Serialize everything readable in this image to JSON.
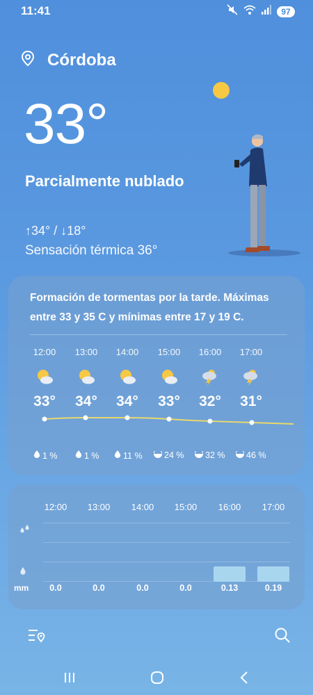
{
  "status": {
    "time": "11:41",
    "battery": "97",
    "icons": [
      "mute-icon",
      "wifi-icon",
      "signal-icon"
    ]
  },
  "header": {
    "city": "Córdoba",
    "current_temp": "33°",
    "condition": "Parcialmente nublado",
    "hi_lo": "↑34° / ↓18°",
    "feels_like": "Sensación térmica 36°"
  },
  "forecast": {
    "summary": "Formación de tormentas por la tarde. Máximas entre 33 y 35 C y mínimas entre 17 y 19 C.",
    "hours": [
      {
        "time": "12:00",
        "icon": "partly-sunny-icon",
        "temp": "33°",
        "precip": "1 %",
        "precip_icon": "drop-icon"
      },
      {
        "time": "13:00",
        "icon": "partly-sunny-icon",
        "temp": "34°",
        "precip": "1 %",
        "precip_icon": "drop-icon"
      },
      {
        "time": "14:00",
        "icon": "partly-sunny-icon",
        "temp": "34°",
        "precip": "11 %",
        "precip_icon": "drop-icon"
      },
      {
        "time": "15:00",
        "icon": "partly-sunny-icon",
        "temp": "33°",
        "precip": "24 %",
        "precip_icon": "half-drop-icon"
      },
      {
        "time": "16:00",
        "icon": "thunderstorm-icon",
        "temp": "32°",
        "precip": "32 %",
        "precip_icon": "half-drop-icon"
      },
      {
        "time": "17:00",
        "icon": "thunderstorm-icon",
        "temp": "31°",
        "precip": "46 %",
        "precip_icon": "half-drop-icon"
      }
    ]
  },
  "rain": {
    "unit": "mm",
    "hours": [
      "12:00",
      "13:00",
      "14:00",
      "15:00",
      "16:00",
      "17:00"
    ],
    "values": [
      "0.0",
      "0.0",
      "0.0",
      "0.0",
      "0.13",
      "0.19"
    ]
  },
  "colors": {
    "background": "#5b9ae0",
    "rain_bar": "#a9d6ef",
    "temp_line": "#e8d96a"
  }
}
